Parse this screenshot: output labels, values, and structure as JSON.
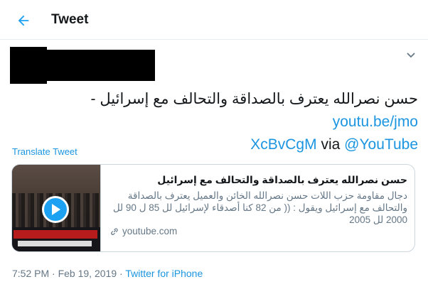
{
  "header": {
    "title": "Tweet"
  },
  "tweet": {
    "line1_text": "حسن نصرالله يعترف بالصداقة والتحالف مع إسرائيل -",
    "line1_link": "youtu.be/jmo",
    "line2_link": "XcBvCgM",
    "line2_via": "via",
    "line2_mention": "@YouTube",
    "translate_label": "Translate Tweet"
  },
  "card": {
    "title": "حسن نصرالله يعترف بالصداقة والتحالف مع إسرائيل",
    "description": "دجال مقاومة حزب اللات حسن نصرالله الخائن والعميل يعترف بالصداقة والتحالف مع إسرائيل ويقول : (( من 82 كنا أصدقاء لإسرائيل لل 85 ل 90 لل 2000 لل 2005",
    "domain": "youtube.com"
  },
  "meta": {
    "time": "7:52 PM",
    "separator": "·",
    "date": "Feb 19, 2019",
    "source": "Twitter for iPhone"
  },
  "colors": {
    "accent": "#1da1f2",
    "link": "#1b95e0",
    "muted": "#657786",
    "border": "#e6ecf0"
  },
  "icons": {
    "back": "arrow-left-icon",
    "more": "chevron-down-icon",
    "play": "play-icon",
    "link": "link-icon"
  }
}
